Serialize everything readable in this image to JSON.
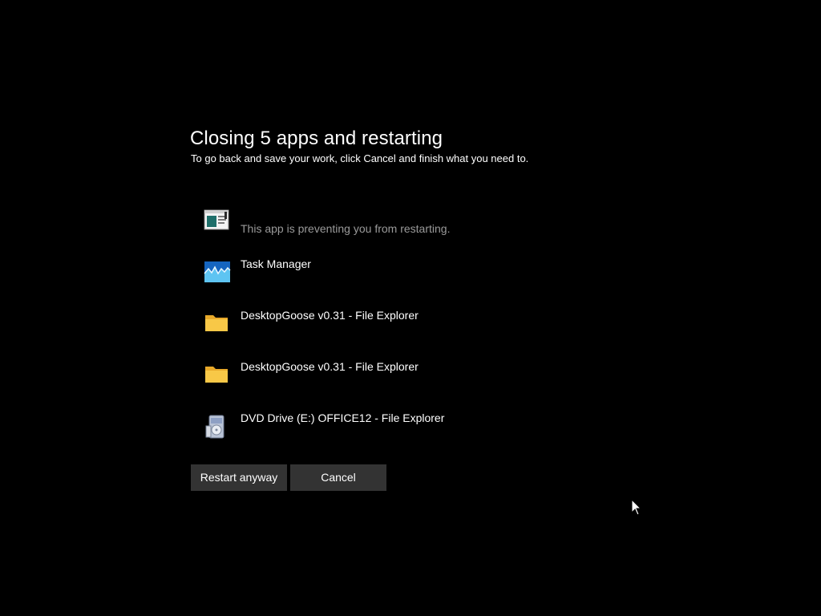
{
  "dialog": {
    "title": "Closing 5 apps and restarting",
    "subtitle": "To go back and save your work, click Cancel and finish what you need to."
  },
  "apps": [
    {
      "name": "",
      "note": "This app is preventing you from restarting.",
      "icon": "app-window-icon"
    },
    {
      "name": "Task Manager",
      "icon": "task-manager-icon"
    },
    {
      "name": "DesktopGoose v0.31 - File Explorer",
      "icon": "folder-icon"
    },
    {
      "name": "DesktopGoose v0.31 - File Explorer",
      "icon": "folder-icon"
    },
    {
      "name": "DVD Drive (E:) OFFICE12 - File Explorer",
      "icon": "installer-disc-icon"
    }
  ],
  "buttons": {
    "restart_label": "Restart anyway",
    "cancel_label": "Cancel"
  },
  "colors": {
    "background": "#000000",
    "text": "#ffffff",
    "note_text": "#9a9a9a",
    "button_bg": "#333333",
    "folder_yellow": "#f8c847",
    "task_manager_blue": "#1e88d8"
  }
}
